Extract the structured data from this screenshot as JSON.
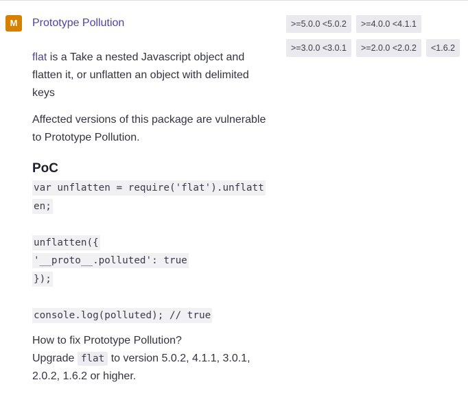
{
  "vulnerability": {
    "severity_letter": "M",
    "severity_color": "#d68000",
    "title": "Prototype Pollution",
    "title_color": "#4b45a1"
  },
  "versions": {
    "row1": [
      ">=5.0.0 <5.0.2",
      ">=4.0.0 <4.1.1"
    ],
    "row2": [
      ">=3.0.0 <3.0.1",
      ">=2.0.0 <2.0.2",
      "<1.6.2"
    ]
  },
  "description": {
    "package_link": "flat",
    "text": " is a Take a nested Javascript object and flatten it, or unflatten an object with delimited keys",
    "affected": "Affected versions of this package are vulnerable to Prototype Pollution."
  },
  "poc": {
    "heading": "PoC",
    "lines": [
      "var unflatten = require('flat').unflatt",
      "en;",
      "",
      "unflatten({",
      "'__proto__.polluted': true",
      "});",
      "",
      "console.log(polluted); // true"
    ]
  },
  "fix": {
    "question": "How to fix Prototype Pollution?",
    "upgrade_prefix": "Upgrade ",
    "package_code": "flat",
    "upgrade_suffix": " to version 5.0.2, 4.1.1, 3.0.1, 2.0.2, 1.6.2 or higher."
  }
}
